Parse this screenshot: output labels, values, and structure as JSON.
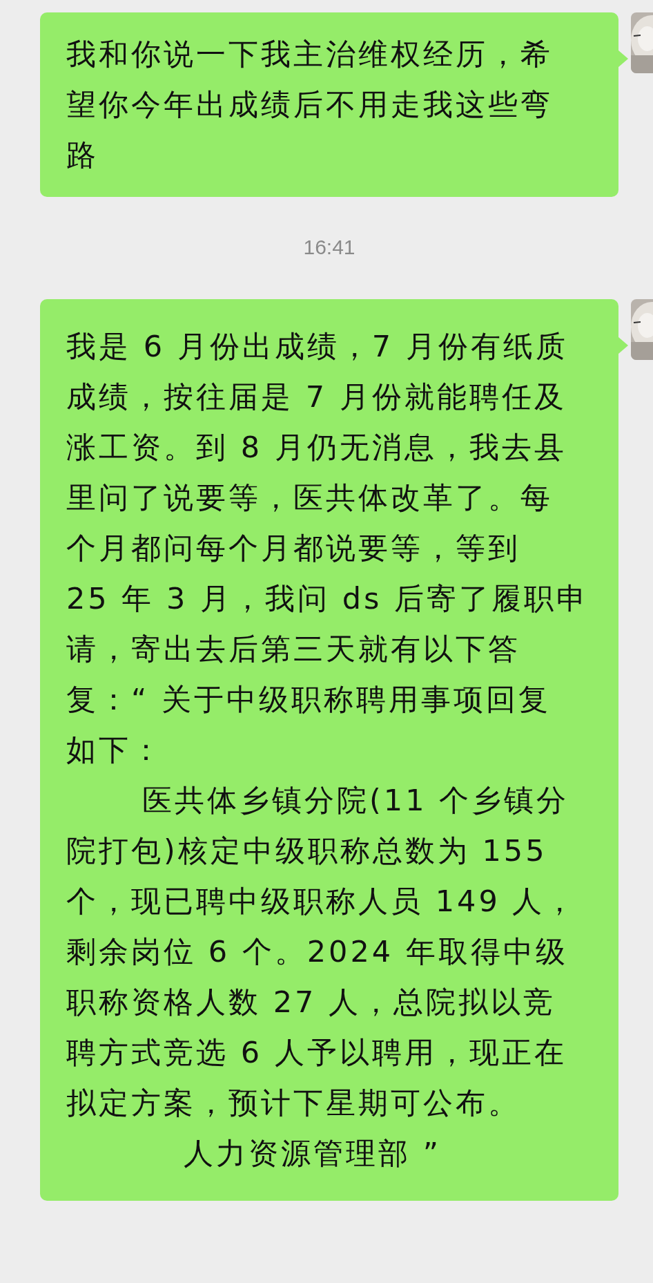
{
  "messages": [
    {
      "kind": "message",
      "lines": [
        {
          "kind": "line",
          "text": "我和你说一下我主治维权经历，希"
        },
        {
          "kind": "line",
          "text": "望你今年出成绩后不用走我这些弯"
        },
        {
          "kind": "line",
          "text": "路"
        }
      ]
    },
    {
      "kind": "time",
      "text": "16:41"
    },
    {
      "kind": "message",
      "lines": [
        {
          "kind": "line",
          "text": "我是 6 月份出成绩，7 月份有纸质"
        },
        {
          "kind": "line",
          "text": "成绩，按往届是 7 月份就能聘任及"
        },
        {
          "kind": "line",
          "text": "涨工资。到 8 月仍无消息，我去县"
        },
        {
          "kind": "line",
          "text": "里问了说要等，医共体改革了。每"
        },
        {
          "kind": "line",
          "text": "个月都问每个月都说要等，等到"
        },
        {
          "kind": "line",
          "text": "25 年 3 月，我问 ds 后寄了履职申"
        },
        {
          "kind": "line",
          "text": "请，寄出去后第三天就有以下答"
        },
        {
          "kind": "line",
          "text": "复：“ 关于中级职称聘用事项回复"
        },
        {
          "kind": "line",
          "text": "如下："
        },
        {
          "kind": "indented",
          "text": "医共体乡镇分院(11 个乡镇分"
        },
        {
          "kind": "line",
          "text": "院打包)核定中级职称总数为 155"
        },
        {
          "kind": "line",
          "text": "个，现已聘中级职称人员 149 人，"
        },
        {
          "kind": "line",
          "text": "剩余岗位 6 个。2024 年取得中级"
        },
        {
          "kind": "line",
          "text": "职称资格人数 27 人，总院拟以竞"
        },
        {
          "kind": "line",
          "text": "聘方式竞选 6 人予以聘用，现正在"
        },
        {
          "kind": "line",
          "text": "拟定方案，预计下星期可公布。"
        },
        {
          "kind": "signature",
          "text": "人力资源管理部 ”"
        }
      ]
    }
  ]
}
